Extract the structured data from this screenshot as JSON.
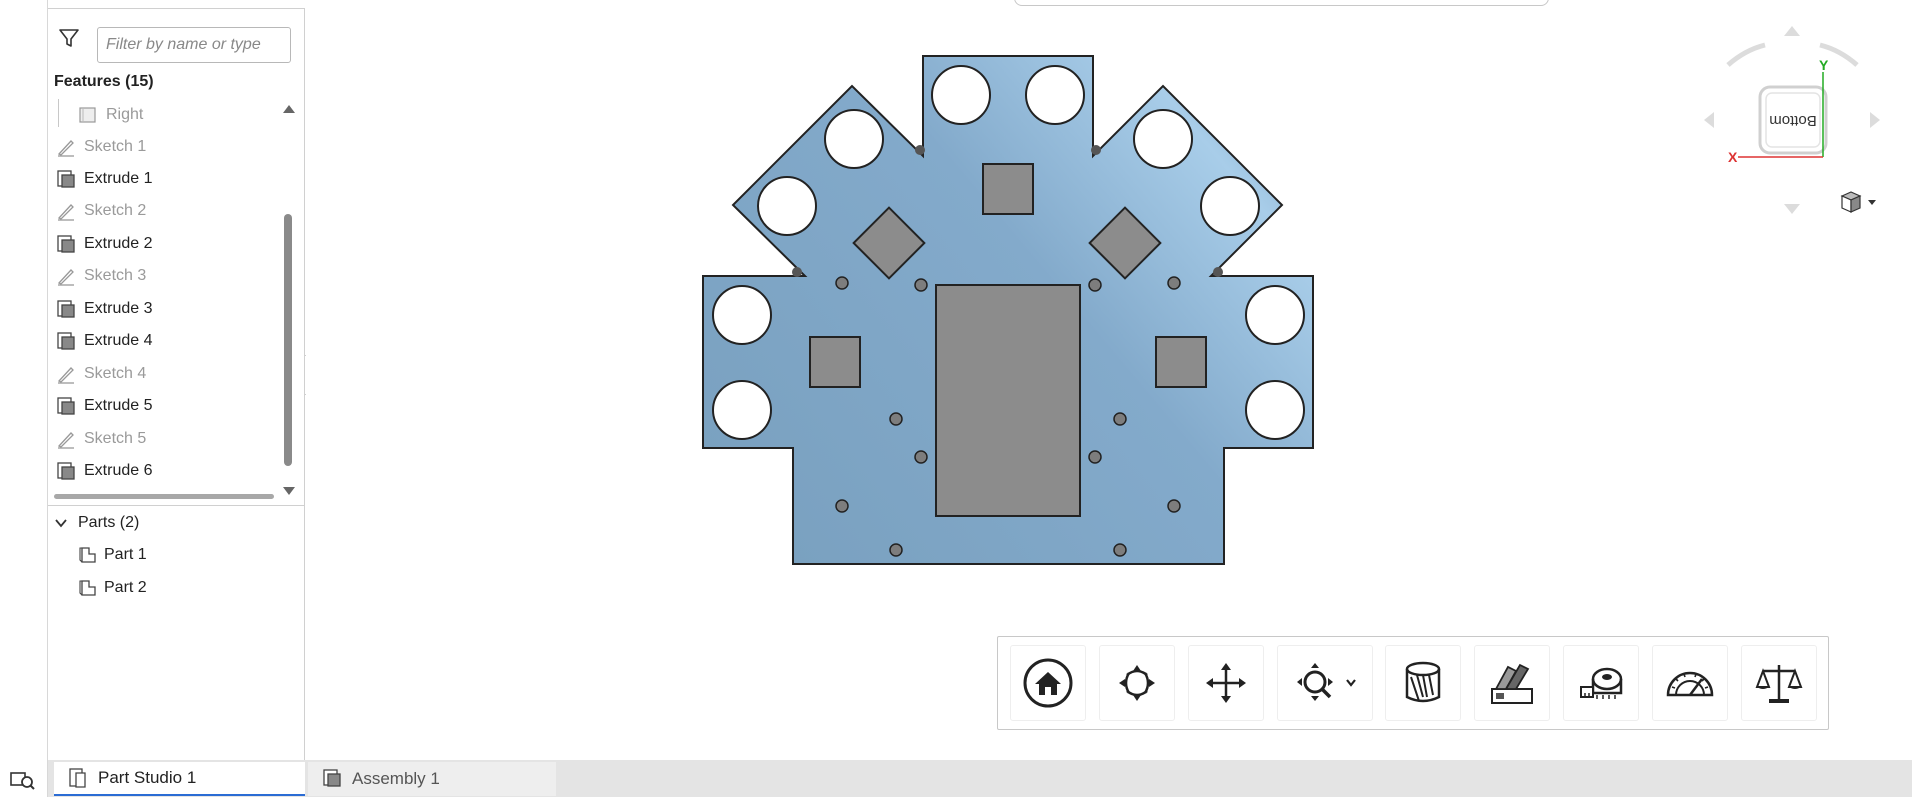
{
  "filter": {
    "placeholder": "Filter by name or type",
    "value": ""
  },
  "features": {
    "title": "Features (15)",
    "items": [
      {
        "label": "Right",
        "type": "plane",
        "dim": true
      },
      {
        "label": "Sketch 1",
        "type": "sketch",
        "dim": true
      },
      {
        "label": "Extrude 1",
        "type": "extrude",
        "dim": false
      },
      {
        "label": "Sketch 2",
        "type": "sketch",
        "dim": true
      },
      {
        "label": "Extrude 2",
        "type": "extrude",
        "dim": false
      },
      {
        "label": "Sketch 3",
        "type": "sketch",
        "dim": true
      },
      {
        "label": "Extrude 3",
        "type": "extrude",
        "dim": false
      },
      {
        "label": "Extrude 4",
        "type": "extrude",
        "dim": false
      },
      {
        "label": "Sketch 4",
        "type": "sketch",
        "dim": true
      },
      {
        "label": "Extrude 5",
        "type": "extrude",
        "dim": false
      },
      {
        "label": "Sketch 5",
        "type": "sketch",
        "dim": true
      },
      {
        "label": "Extrude 6",
        "type": "extrude",
        "dim": false
      }
    ]
  },
  "parts": {
    "title": "Parts (2)",
    "items": [
      {
        "label": "Part 1"
      },
      {
        "label": "Part 2"
      }
    ]
  },
  "viewcube": {
    "face_label": "Bottom",
    "x_axis": "X",
    "y_axis": "Y"
  },
  "toolbar": {
    "tools": [
      {
        "name": "home-view",
        "icon": "home-icon"
      },
      {
        "name": "rotate-view",
        "icon": "rotate-icon"
      },
      {
        "name": "pan-view",
        "icon": "pan-icon"
      },
      {
        "name": "zoom-view",
        "icon": "zoom-icon"
      },
      {
        "name": "section-view",
        "icon": "section-icon"
      },
      {
        "name": "appearance",
        "icon": "swatch-icon"
      },
      {
        "name": "measure",
        "icon": "tape-measure-icon"
      },
      {
        "name": "angle",
        "icon": "protractor-icon"
      },
      {
        "name": "mass-properties",
        "icon": "balance-icon"
      }
    ]
  },
  "tabs": {
    "items": [
      {
        "label": "Part Studio 1",
        "active": true
      },
      {
        "label": "Assembly 1",
        "active": false
      }
    ]
  },
  "colors": {
    "part_fill": "#7aa3c4",
    "part_highlight": "#b5d6ef",
    "pocket": "#8a8a8a",
    "accent": "#2b6cd4",
    "axis_x": "#d33",
    "axis_y": "#2a2"
  }
}
